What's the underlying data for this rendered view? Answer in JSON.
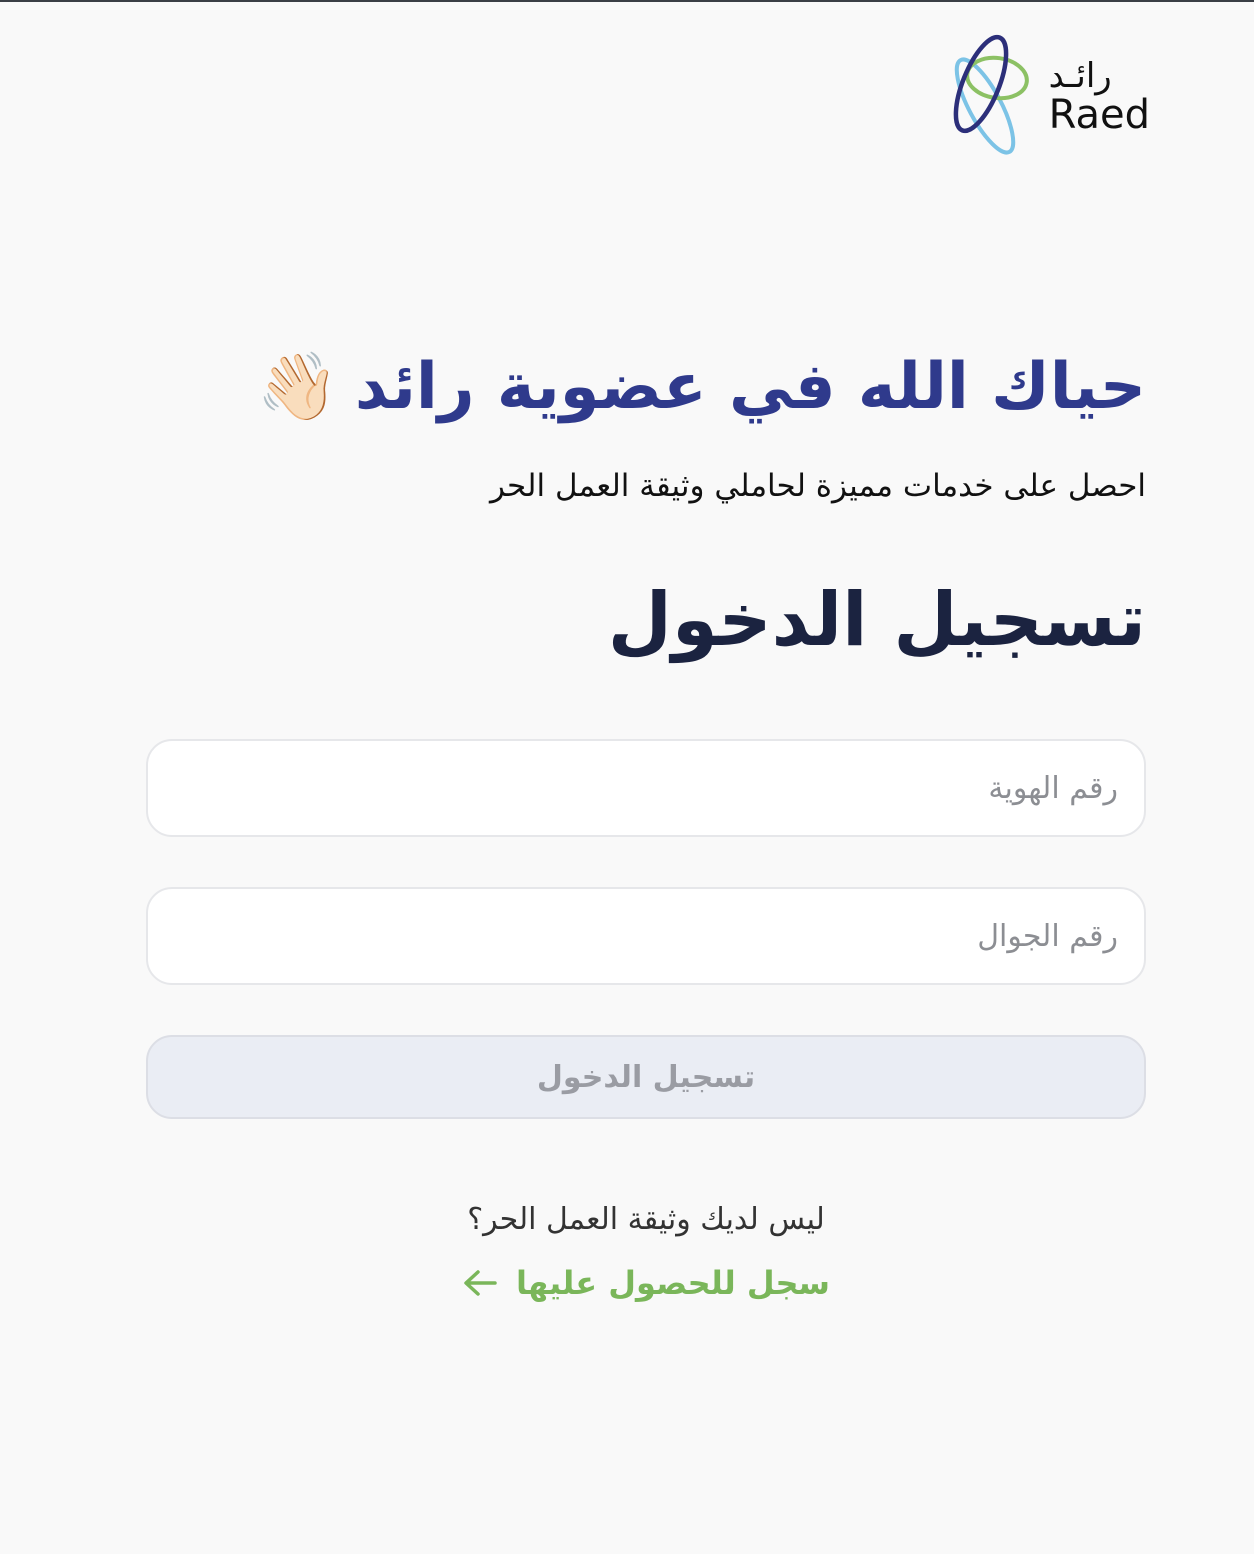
{
  "brand": {
    "name_ar": "رائـد",
    "name_en": "Raed"
  },
  "hero": {
    "welcome": "حياك الله في عضوية رائد",
    "wave_emoji": "👋🏻",
    "subtitle": "احصل على خدمات مميزة لحاملي وثيقة العمل الحر"
  },
  "login": {
    "title": "تسجيل الدخول",
    "id_placeholder": "رقم الهوية",
    "phone_placeholder": "رقم الجوال",
    "submit_label": "تسجيل الدخول",
    "submit_disabled": true
  },
  "signup": {
    "question": "ليس لديك وثيقة العمل الحر؟",
    "link_label": "سجل للحصول عليها",
    "link_icon": "arrow-left-icon"
  },
  "colors": {
    "primary": "#2f3a8c",
    "heading": "#1b2340",
    "accent_green": "#7ab65a",
    "logo_navy": "#2c2f7a",
    "logo_blue": "#7cc3e6",
    "logo_green": "#8cc164",
    "button_bg": "#eaedf4",
    "button_text": "#9a9ca3",
    "background": "#f9f9f9"
  }
}
